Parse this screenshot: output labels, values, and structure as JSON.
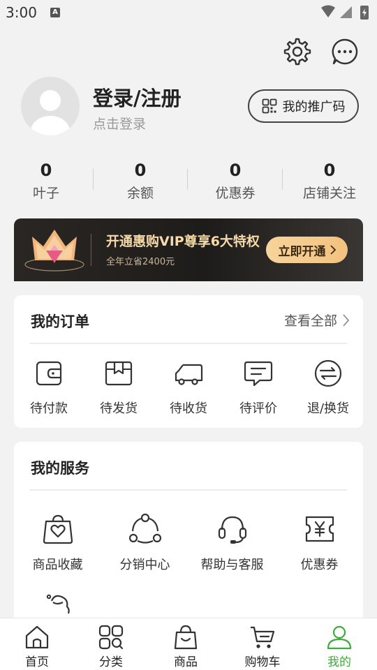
{
  "status": {
    "time": "3:00",
    "a_badge": "A"
  },
  "profile": {
    "name": "登录/注册",
    "subtitle": "点击登录",
    "promo_label": "我的推广码"
  },
  "stats": [
    {
      "value": "0",
      "label": "叶子"
    },
    {
      "value": "0",
      "label": "余额"
    },
    {
      "value": "0",
      "label": "优惠券"
    },
    {
      "value": "0",
      "label": "店铺关注"
    }
  ],
  "vip": {
    "title": "开通惠购VIP尊享6大特权",
    "subtitle": "全年立省2400元",
    "button": "立即开通"
  },
  "orders": {
    "title": "我的订单",
    "view_all": "查看全部",
    "items": [
      {
        "label": "待付款",
        "icon": "wallet-icon"
      },
      {
        "label": "待发货",
        "icon": "box-icon"
      },
      {
        "label": "待收货",
        "icon": "truck-icon"
      },
      {
        "label": "待评价",
        "icon": "comment-icon"
      },
      {
        "label": "退/换货",
        "icon": "exchange-icon"
      }
    ]
  },
  "services": {
    "title": "我的服务",
    "items": [
      {
        "label": "商品收藏",
        "icon": "bag-heart-icon"
      },
      {
        "label": "分销中心",
        "icon": "share-nodes-icon"
      },
      {
        "label": "帮助与客服",
        "icon": "headset-icon"
      },
      {
        "label": "优惠券",
        "icon": "coupon-icon"
      }
    ]
  },
  "nav": [
    {
      "label": "首页",
      "icon": "home-icon"
    },
    {
      "label": "分类",
      "icon": "category-icon"
    },
    {
      "label": "商品",
      "icon": "shopping-bag-icon"
    },
    {
      "label": "购物车",
      "icon": "cart-icon"
    },
    {
      "label": "我的",
      "icon": "user-icon",
      "active": true
    }
  ],
  "colors": {
    "accent": "#3dac3a",
    "vip_gold": "#f5d9a8",
    "background": "#f2f2f2"
  }
}
